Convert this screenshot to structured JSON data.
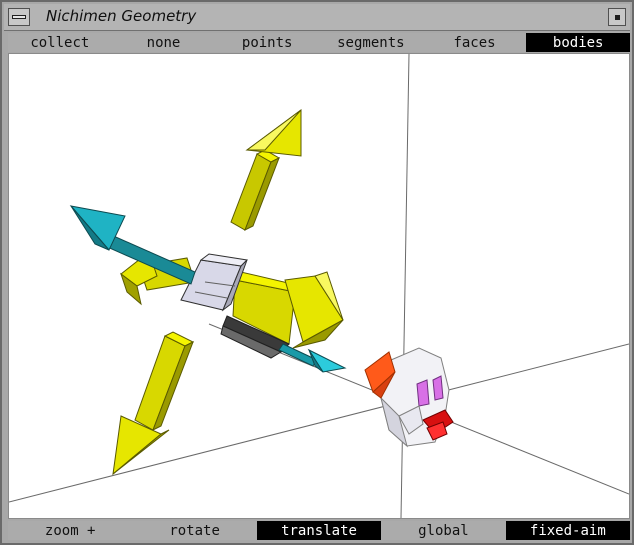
{
  "window": {
    "title": "Nichimen Geometry"
  },
  "icons": {
    "window_menu": "window-menu-icon",
    "window_control": "window-minimize-icon"
  },
  "top_menu": {
    "items": [
      {
        "label": "collect",
        "active": false
      },
      {
        "label": "none",
        "active": false
      },
      {
        "label": "points",
        "active": false
      },
      {
        "label": "segments",
        "active": false
      },
      {
        "label": "faces",
        "active": false
      },
      {
        "label": "bodies",
        "active": true
      }
    ]
  },
  "bottom_menu": {
    "items": [
      {
        "label": "zoom +",
        "active": false
      },
      {
        "label": "rotate",
        "active": false
      },
      {
        "label": "translate",
        "active": true
      },
      {
        "label": "global",
        "active": false
      },
      {
        "label": "fixed-aim",
        "active": true
      }
    ]
  },
  "colors": {
    "active_bg": "#000000",
    "bar_bg": "#ababab",
    "viewport_bg": "#ffffff",
    "arrow_yellow": "#e6e600",
    "arrow_cyan": "#1fb3c4",
    "head_orange": "#ff5a1a",
    "head_red": "#d81010",
    "eye_purple": "#d870e6"
  }
}
